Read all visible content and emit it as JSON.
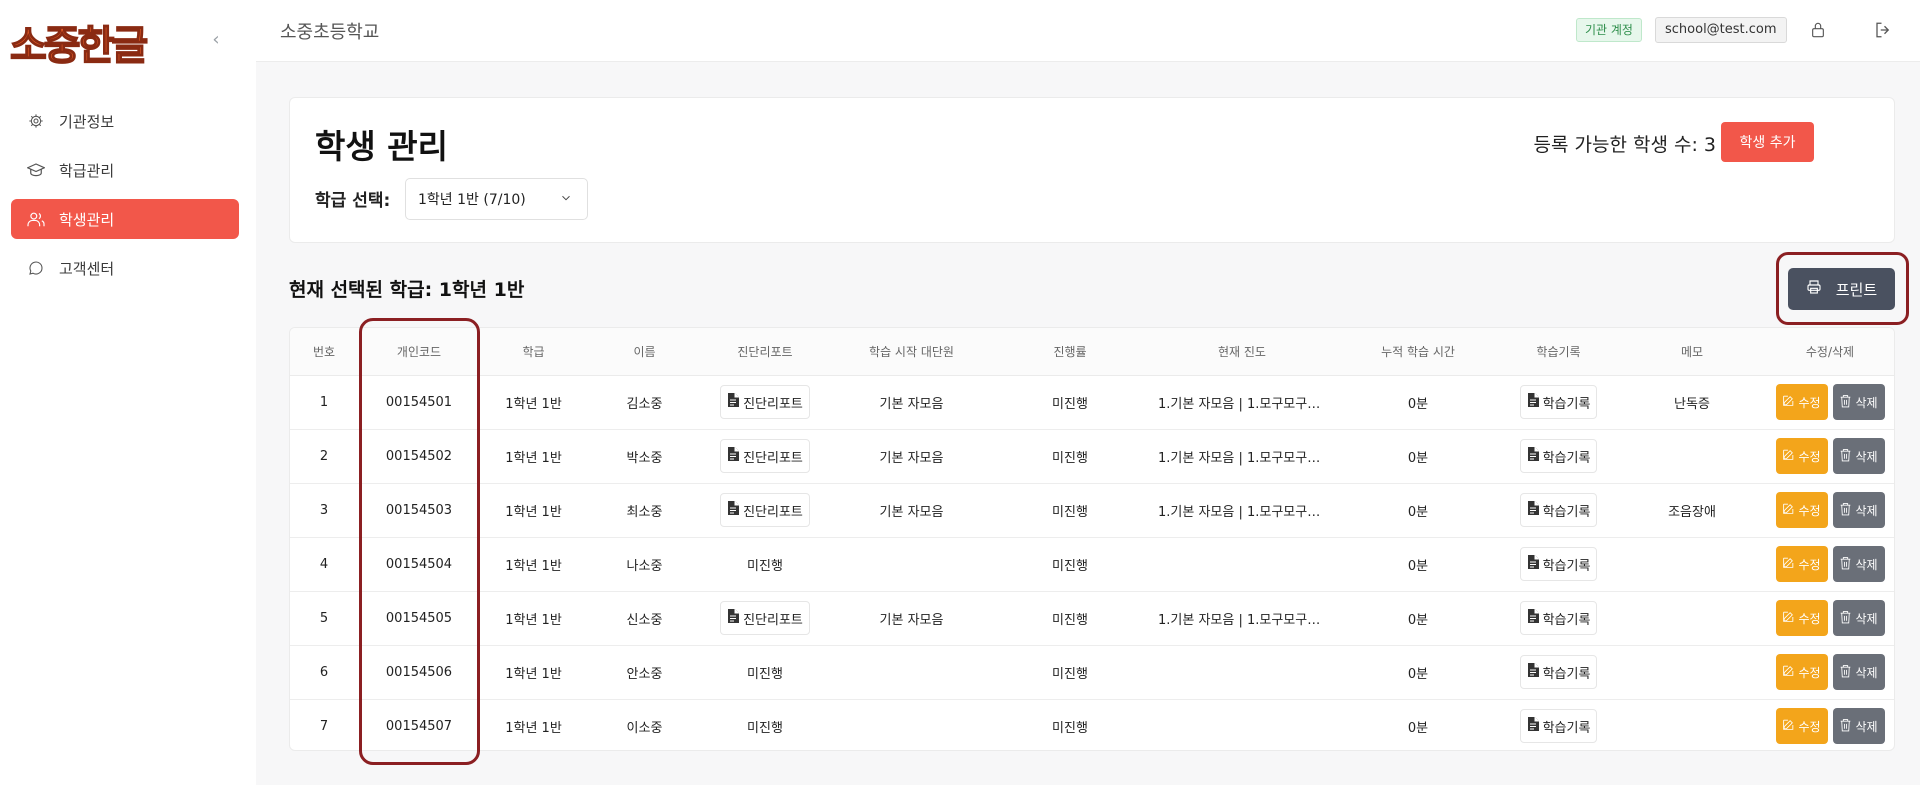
{
  "app": {
    "logo_text": "소중한글",
    "collapse_glyph": "‹"
  },
  "sidebar": {
    "items": [
      {
        "label": "기관정보",
        "icon": "gear-icon",
        "active": false
      },
      {
        "label": "학급관리",
        "icon": "graduation-cap-icon",
        "active": false
      },
      {
        "label": "학생관리",
        "icon": "users-icon",
        "active": true
      },
      {
        "label": "고객센터",
        "icon": "chat-bubble-icon",
        "active": false
      }
    ]
  },
  "header": {
    "title": "소중초등학교",
    "account_badge": "기관 계정",
    "email": "school@test.com"
  },
  "page": {
    "title": "학생 관리",
    "registrable_label": "등록 가능한 학생 수: 3",
    "add_button": "학생 추가",
    "class_select_label": "학급 선택:",
    "class_select_value": "1학년 1반 (7/10)",
    "current_class_text": "현재 선택된 학급: 1학년 1반",
    "print_button": "프린트"
  },
  "table": {
    "headers": [
      "번호",
      "개인코드",
      "학급",
      "이름",
      "진단리포트",
      "학습 시작 대단원",
      "진행률",
      "현재 진도",
      "누적 학습 시간",
      "학습기록",
      "메모",
      "수정/삭제"
    ],
    "report_button_label": "진단리포트",
    "record_button_label": "학습기록",
    "edit_label": "수정",
    "delete_label": "삭제",
    "rows": [
      {
        "no": "1",
        "code": "00154501",
        "class": "1학년 1반",
        "name": "김소중",
        "report": "button",
        "report_text": "",
        "start_unit": "기본 자모음",
        "progress": "미진행",
        "current": "1.기본 자모음 | 1.모구모구동...",
        "time": "0분",
        "memo": "난독증"
      },
      {
        "no": "2",
        "code": "00154502",
        "class": "1학년 1반",
        "name": "박소중",
        "report": "button",
        "report_text": "",
        "start_unit": "기본 자모음",
        "progress": "미진행",
        "current": "1.기본 자모음 | 1.모구모구동...",
        "time": "0분",
        "memo": ""
      },
      {
        "no": "3",
        "code": "00154503",
        "class": "1학년 1반",
        "name": "최소중",
        "report": "button",
        "report_text": "",
        "start_unit": "기본 자모음",
        "progress": "미진행",
        "current": "1.기본 자모음 | 1.모구모구동...",
        "time": "0분",
        "memo": "조음장애"
      },
      {
        "no": "4",
        "code": "00154504",
        "class": "1학년 1반",
        "name": "나소중",
        "report": "text",
        "report_text": "미진행",
        "start_unit": "",
        "progress": "미진행",
        "current": "",
        "time": "0분",
        "memo": ""
      },
      {
        "no": "5",
        "code": "00154505",
        "class": "1학년 1반",
        "name": "신소중",
        "report": "button",
        "report_text": "",
        "start_unit": "기본 자모음",
        "progress": "미진행",
        "current": "1.기본 자모음 | 1.모구모구동...",
        "time": "0분",
        "memo": ""
      },
      {
        "no": "6",
        "code": "00154506",
        "class": "1학년 1반",
        "name": "안소중",
        "report": "text",
        "report_text": "미진행",
        "start_unit": "",
        "progress": "미진행",
        "current": "",
        "time": "0분",
        "memo": ""
      },
      {
        "no": "7",
        "code": "00154507",
        "class": "1학년 1반",
        "name": "이소중",
        "report": "text",
        "report_text": "미진행",
        "start_unit": "",
        "progress": "미진행",
        "current": "",
        "time": "0분",
        "memo": ""
      }
    ]
  },
  "colors": {
    "brand": "#f2574a",
    "edit": "#f3a51b",
    "delete": "#6a6f78",
    "print": "#4a5160",
    "highlight_ring": "#8b1f22"
  }
}
